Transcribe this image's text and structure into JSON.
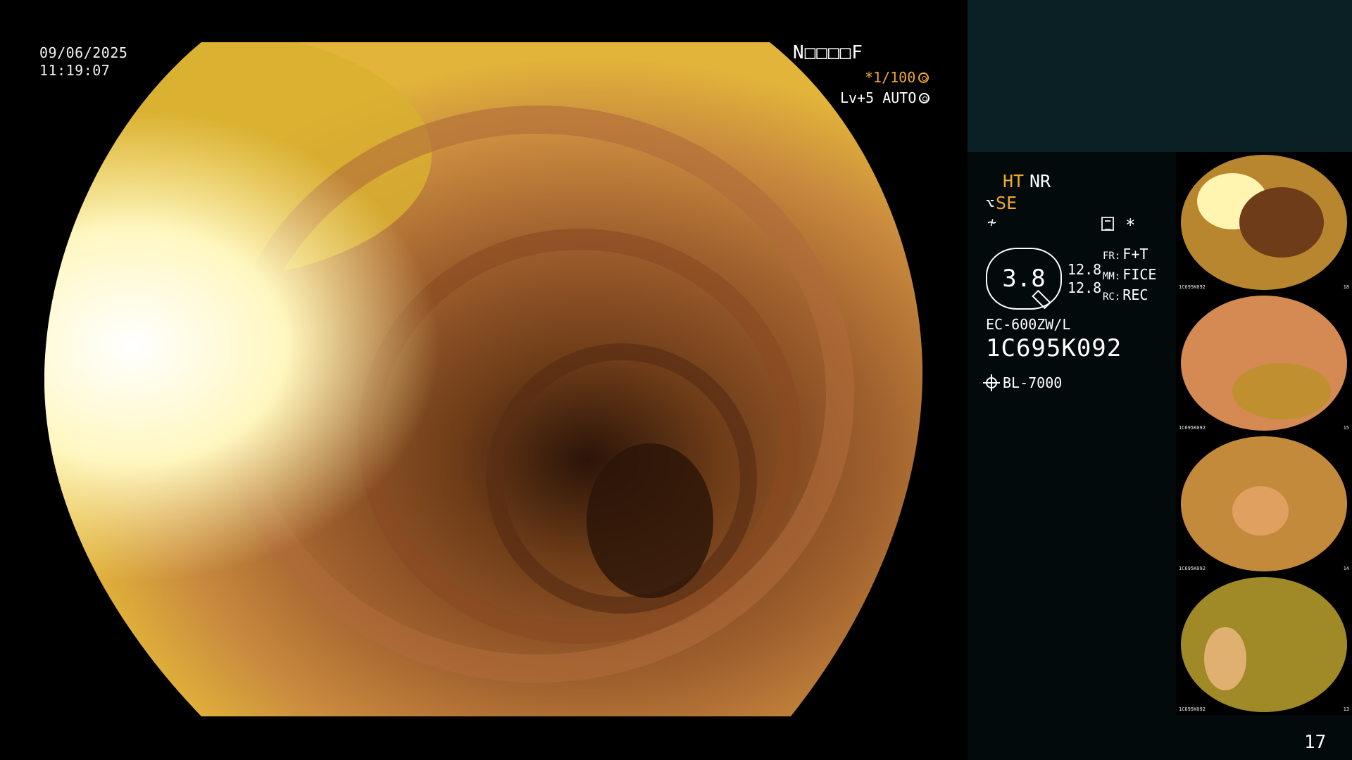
{
  "main": {
    "date": "09/06/2025",
    "time": "11:19:07",
    "patient_id": "N□□□□F",
    "shutter": "*1/100",
    "level": "Lv+5 AUTO"
  },
  "panel": {
    "ht": "HT",
    "nr": "NR",
    "se": "SE",
    "zoom": "3.8",
    "values": [
      "12.8",
      "12.8"
    ],
    "labels": [
      {
        "k": "FR:",
        "v": "F+T"
      },
      {
        "k": "MM:",
        "v": "FICE"
      },
      {
        "k": "RC:",
        "v": "REC"
      }
    ],
    "scope_model": "EC-600ZW/L",
    "scope_serial": "1C695K092",
    "light_source": "BL-7000"
  },
  "thumbnails": [
    {
      "label": "1C695K092",
      "num": "18"
    },
    {
      "label": "1C695K092",
      "num": "15"
    },
    {
      "label": "1C695K092",
      "num": "14"
    },
    {
      "label": "1C695K092",
      "num": "13"
    }
  ],
  "page_number": "17",
  "colors": {
    "accent": "#f0a830",
    "side_top": "#0b2024",
    "side_panel": "#030a0b"
  },
  "icons": [
    "shutter-icon",
    "auto-icon",
    "list-icon",
    "light-source-icon"
  ]
}
